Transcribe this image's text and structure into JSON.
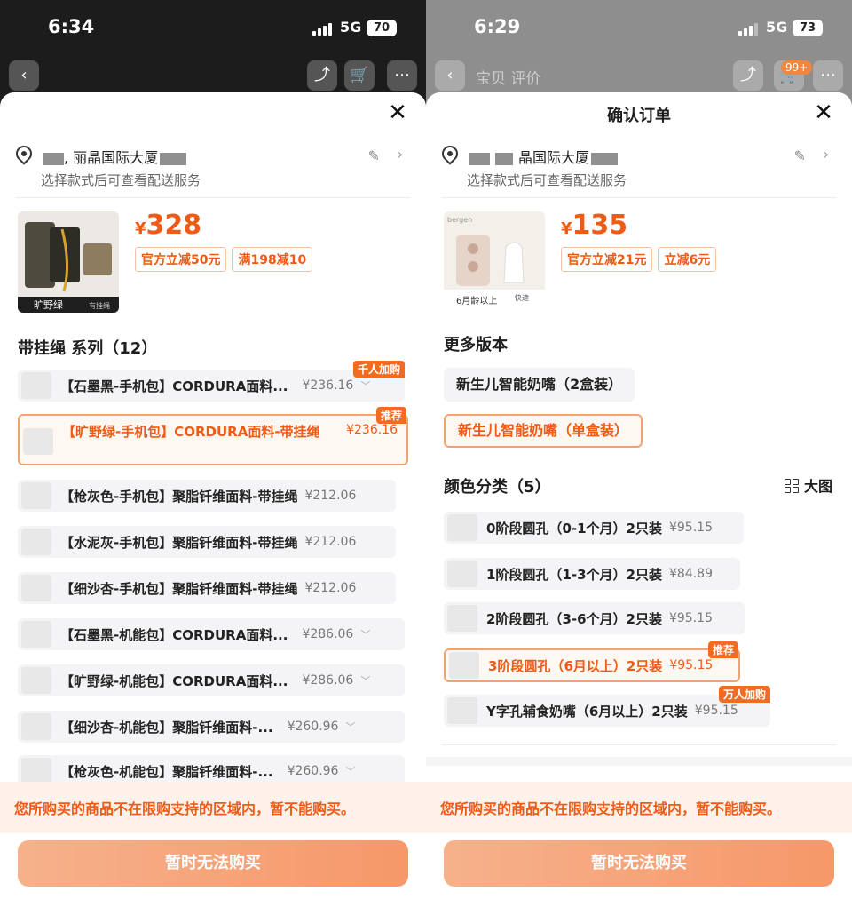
{
  "left": {
    "status": {
      "time": "6:34",
      "network": "5G",
      "battery": "70"
    },
    "address": {
      "text": "丽晶国际大厦",
      "subtitle": "选择款式后可查看配送服务"
    },
    "product": {
      "image_label": "旷野绿",
      "image_sublabel": "有挂绳",
      "currency": "¥",
      "price": "328",
      "tags": [
        "官方立减50元",
        "满198减10"
      ]
    },
    "section_title": "带挂绳 系列（12）",
    "options": [
      {
        "label": "【石墨黑-手机包】CORDURA面料...",
        "price": "¥236.16",
        "flag": "千人加购"
      },
      {
        "label": "【旷野绿-手机包】CORDURA面料-带挂绳",
        "price": "¥236.16",
        "flag": "推荐",
        "selected": true
      },
      {
        "label": "【枪灰色-手机包】聚脂钎维面料-带挂绳",
        "price": "¥212.06"
      },
      {
        "label": "【水泥灰-手机包】聚脂钎维面料-带挂绳",
        "price": "¥212.06"
      },
      {
        "label": "【细沙杏-手机包】聚脂钎维面料-带挂绳",
        "price": "¥212.06"
      },
      {
        "label": "【石墨黑-机能包】CORDURA面料...",
        "price": "¥286.06"
      },
      {
        "label": "【旷野绿-机能包】CORDURA面料...",
        "price": "¥286.06"
      },
      {
        "label": "【细沙杏-机能包】聚脂钎维面料-...",
        "price": "¥260.96"
      },
      {
        "label": "【枪灰色-机能包】聚脂钎维面料-...",
        "price": "¥260.96"
      }
    ],
    "warning": "您所购买的商品不在限购支持的区域内，暂不能购买。",
    "buy_button": "暂时无法购买"
  },
  "right": {
    "status": {
      "time": "6:29",
      "network": "5G",
      "battery": "73"
    },
    "bg_header": {
      "title": "宝贝  评价",
      "cart_badge": "99+"
    },
    "sheet_title": "确认订单",
    "address": {
      "text": "晶国际大厦",
      "subtitle": "选择款式后可查看配送服务"
    },
    "product": {
      "brand": "bergen",
      "image_label": "6月龄以上",
      "image_sublabel": "快速",
      "currency": "¥",
      "price": "135",
      "tags": [
        "官方立减21元",
        "立减6元"
      ]
    },
    "versions_title": "更多版本",
    "versions": [
      {
        "label": "新生儿智能奶嘴（2盒装）"
      },
      {
        "label": "新生儿智能奶嘴（单盒装）",
        "selected": true
      }
    ],
    "color_title": "颜色分类（5）",
    "big_image_label": "大图",
    "options": [
      {
        "label": "0阶段圆孔（0-1个月）2只装",
        "price": "¥95.15"
      },
      {
        "label": "1阶段圆孔（1-3个月）2只装",
        "price": "¥84.89"
      },
      {
        "label": "2阶段圆孔（3-6个月）2只装",
        "price": "¥95.15"
      },
      {
        "label": "3阶段圆孔（6月以上）2只装",
        "price": "¥95.15",
        "flag": "推荐",
        "selected": true
      },
      {
        "label": "Y字孔辅食奶嘴（6月以上）2只装",
        "price": "¥95.15",
        "flag": "万人加购"
      }
    ],
    "warning": "您所购买的商品不在限购支持的区域内，暂不能购买。",
    "buy_button": "暂时无法购买"
  },
  "colors": {
    "accent": "#f05a14",
    "button": "#f69869",
    "warning_bg": "#fff2ea"
  }
}
